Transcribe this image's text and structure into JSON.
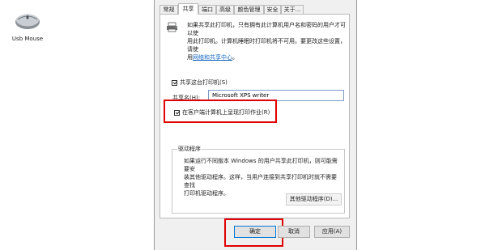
{
  "desktop": {
    "icon_label": "Usb Mouse"
  },
  "dialog": {
    "tabs": [
      "常规",
      "共享",
      "端口",
      "高级",
      "颜色管理",
      "安全",
      "关于..."
    ],
    "description_line1": "如果共享此打印机，只有拥有此计算机用户名和密码的用户才可以使",
    "description_line2": "用此打印机。计算机睡眠时打印机将不可用。要更改这些设置，请使",
    "description_prefix": "用",
    "description_link": "网络和共享中心",
    "description_suffix": "。",
    "share_checkbox_label": "共享这台打印机(S)",
    "share_name_label": "共享名(H):",
    "share_name_value": "Microsoft XPS writer",
    "render_checkbox_label": "在客户端计算机上呈现打印作业(R)",
    "driver_group_title": "驱动程序",
    "driver_text_line1": "如果运行不同版本 Windows 的用户共享此打印机，则可能需要安",
    "driver_text_line2": "装其他驱动程序。这样，当用户连接到共享打印机时就不需要查找",
    "driver_text_line3": "打印机驱动程序。",
    "other_drivers_button": "其他驱动程序(D)...",
    "ok_button": "确定",
    "cancel_button": "取消",
    "apply_button": "应用(A)"
  },
  "colors": {
    "highlight_red": "#e00000",
    "link_blue": "#1565c0"
  },
  "icons": [
    "usb-mouse-icon",
    "printer-share-icon",
    "checkbox-checked-icon"
  ]
}
